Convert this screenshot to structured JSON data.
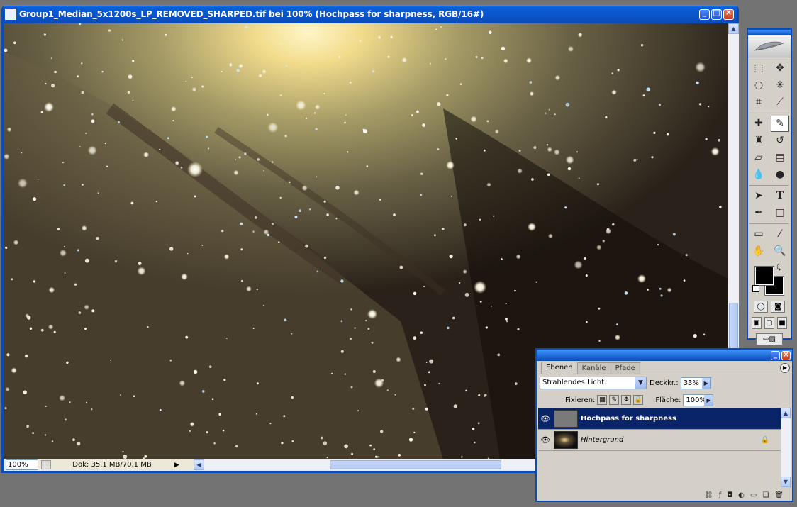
{
  "document_window": {
    "title": "Group1_Median_5x1200s_LP_REMOVED_SHARPED.tif bei 100% (Hochpass for sharpness, RGB/16#)",
    "status": {
      "zoom": "100%",
      "doc_size": "Dok: 35,1 MB/70,1 MB"
    }
  },
  "tools_palette": {
    "tools": [
      "rect-marquee",
      "move",
      "lasso",
      "magic-wand",
      "crop",
      "slice",
      "healing-brush",
      "brush",
      "clone-stamp",
      "history-brush",
      "eraser",
      "gradient",
      "blur",
      "dodge",
      "path-select",
      "type",
      "pen",
      "shape",
      "notes",
      "eyedropper",
      "hand",
      "zoom"
    ],
    "selected_tool": "brush",
    "foreground_color": "#000000",
    "background_color": "#000000"
  },
  "layers_palette": {
    "tabs": [
      "Ebenen",
      "Kanäle",
      "Pfade"
    ],
    "active_tab": "Ebenen",
    "blend_mode": "Strahlendes Licht",
    "opacity_label": "Deckkr.:",
    "opacity": "33%",
    "lock_label": "Fixieren:",
    "fill_label": "Fläche:",
    "fill": "100%",
    "layers": [
      {
        "name": "Hochpass for sharpness",
        "selected": true,
        "visible": true
      },
      {
        "name": "Hintergrund",
        "selected": false,
        "visible": true,
        "locked": true
      }
    ]
  },
  "colors": {
    "titlebar": "#0a4bb8",
    "selection": "#0a246a",
    "panel": "#d4d0c8",
    "desktop": "#737373"
  }
}
